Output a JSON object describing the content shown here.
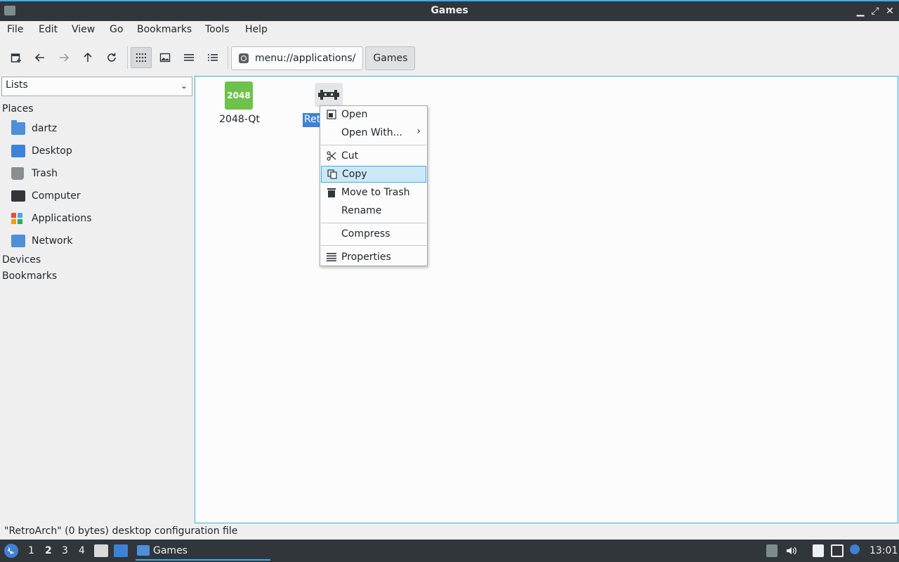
{
  "window": {
    "title": "Games",
    "controls": {
      "minimize": "▁",
      "maximize": "⤢",
      "close": "✕"
    }
  },
  "menubar": [
    "File",
    "Edit",
    "View",
    "Go",
    "Bookmarks",
    "Tools",
    "Help"
  ],
  "toolbar": {
    "buttons": [
      "new-tab-icon",
      "back-icon",
      "forward-icon",
      "up-icon",
      "reload-icon",
      "icon-view-icon",
      "thumbnail-view-icon",
      "compact-view-icon",
      "detailed-list-view-icon"
    ],
    "path": {
      "root": "menu://applications/",
      "current": "Games"
    }
  },
  "sidebar": {
    "mode": "Lists",
    "places_header": "Places",
    "places": [
      "dartz",
      "Desktop",
      "Trash",
      "Computer",
      "Applications",
      "Network"
    ],
    "devices_header": "Devices",
    "bookmarks_header": "Bookmarks"
  },
  "files": [
    {
      "name": "2048-Qt",
      "icon_text": "2048"
    },
    {
      "name": "RetroArch",
      "visible_label": "Ret",
      "selected": true
    }
  ],
  "context_menu": {
    "items": [
      "Open",
      "Open With...",
      "Cut",
      "Copy",
      "Move to Trash",
      "Rename",
      "Compress",
      "Properties"
    ],
    "submenu_arrow": "›",
    "highlighted": "Copy"
  },
  "statusbar": {
    "text": "\"RetroArch\" (0 bytes) desktop configuration file"
  },
  "taskbar": {
    "workspaces": [
      "1",
      "2",
      "3",
      "4"
    ],
    "current_workspace": "2",
    "task": "Games",
    "clock": "13:01"
  },
  "colors": {
    "accent": "#3daee9",
    "titlebar": "#31363b",
    "selection": "#3d82d6",
    "menu_highlight": "#cce8f4",
    "tile_2048": "#6cc24a"
  }
}
